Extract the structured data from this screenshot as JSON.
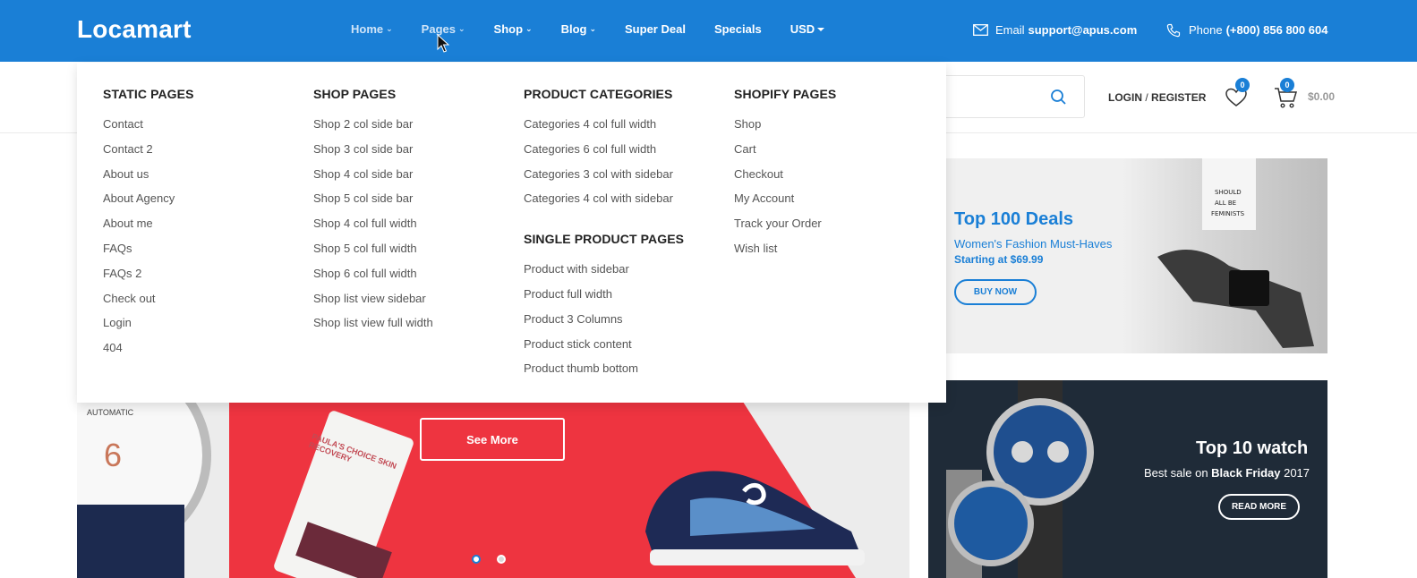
{
  "logo": "Locamart",
  "nav": [
    {
      "label": "Home",
      "dropdown": true
    },
    {
      "label": "Pages",
      "dropdown": true
    },
    {
      "label": "Shop",
      "dropdown": true
    },
    {
      "label": "Blog",
      "dropdown": true
    },
    {
      "label": "Super Deal",
      "dropdown": false
    },
    {
      "label": "Specials",
      "dropdown": false
    },
    {
      "label": "USD",
      "dropdown": true
    }
  ],
  "contact": {
    "email_label": "Email",
    "email": "support@apus.com",
    "phone_label": "Phone",
    "phone": "(+800) 856 800 604"
  },
  "header": {
    "login": "LOGIN",
    "separator": "/",
    "register": "REGISTER",
    "wishlist_count": "0",
    "cart_count": "0",
    "cart_total": "$0.00"
  },
  "mega_menu": {
    "static_pages": {
      "title": "STATIC PAGES",
      "items": [
        "Contact",
        "Contact 2",
        "About us",
        "About Agency",
        "About me",
        "FAQs",
        "FAQs 2",
        "Check out",
        "Login",
        "404"
      ]
    },
    "shop_pages": {
      "title": "SHOP PAGES",
      "items": [
        "Shop 2 col side bar",
        "Shop 3 col side bar",
        "Shop 4 col side bar",
        "Shop 5 col side bar",
        "Shop 4 col full width",
        "Shop 5 col full width",
        "Shop 6 col full width",
        "Shop list view sidebar",
        "Shop list view full width"
      ]
    },
    "product_categories": {
      "title": "PRODUCT CATEGORIES",
      "items": [
        "Categories 4 col full width",
        "Categories 6 col full width",
        "Categories 3 col with sidebar",
        "Categories 4 col with sidebar"
      ]
    },
    "single_product_pages": {
      "title": "SINGLE PRODUCT PAGES",
      "items": [
        "Product with sidebar",
        "Product full width",
        "Product 3 Columns",
        "Product stick content",
        "Product thumb bottom"
      ]
    },
    "shopify_pages": {
      "title": "SHOPIFY PAGES",
      "items": [
        "Shop",
        "Cart",
        "Checkout",
        "My Account",
        "Track your Order",
        "Wish list"
      ]
    }
  },
  "hero": {
    "button": "See More",
    "watch_label": "AUTOMATIC",
    "watch_numeral": "6",
    "tube_text": "PAULA'S CHOICE SKIN RECOVERY",
    "active_slide": 1
  },
  "deal_banner": {
    "title": "Top 100 Deals",
    "subtitle": "Women's Fashion Must-Haves",
    "price": "Starting at $69.99",
    "button": "BUY NOW"
  },
  "watch_banner": {
    "title": "Top 10 watch",
    "subtitle_pre": "Best sale on ",
    "subtitle_bold": "Black Friday",
    "subtitle_post": " 2017",
    "button": "READ MORE"
  },
  "colors": {
    "brand_blue": "#1a7fd6",
    "hero_red": "#ee3440",
    "watch_bg": "#1f2b38"
  }
}
